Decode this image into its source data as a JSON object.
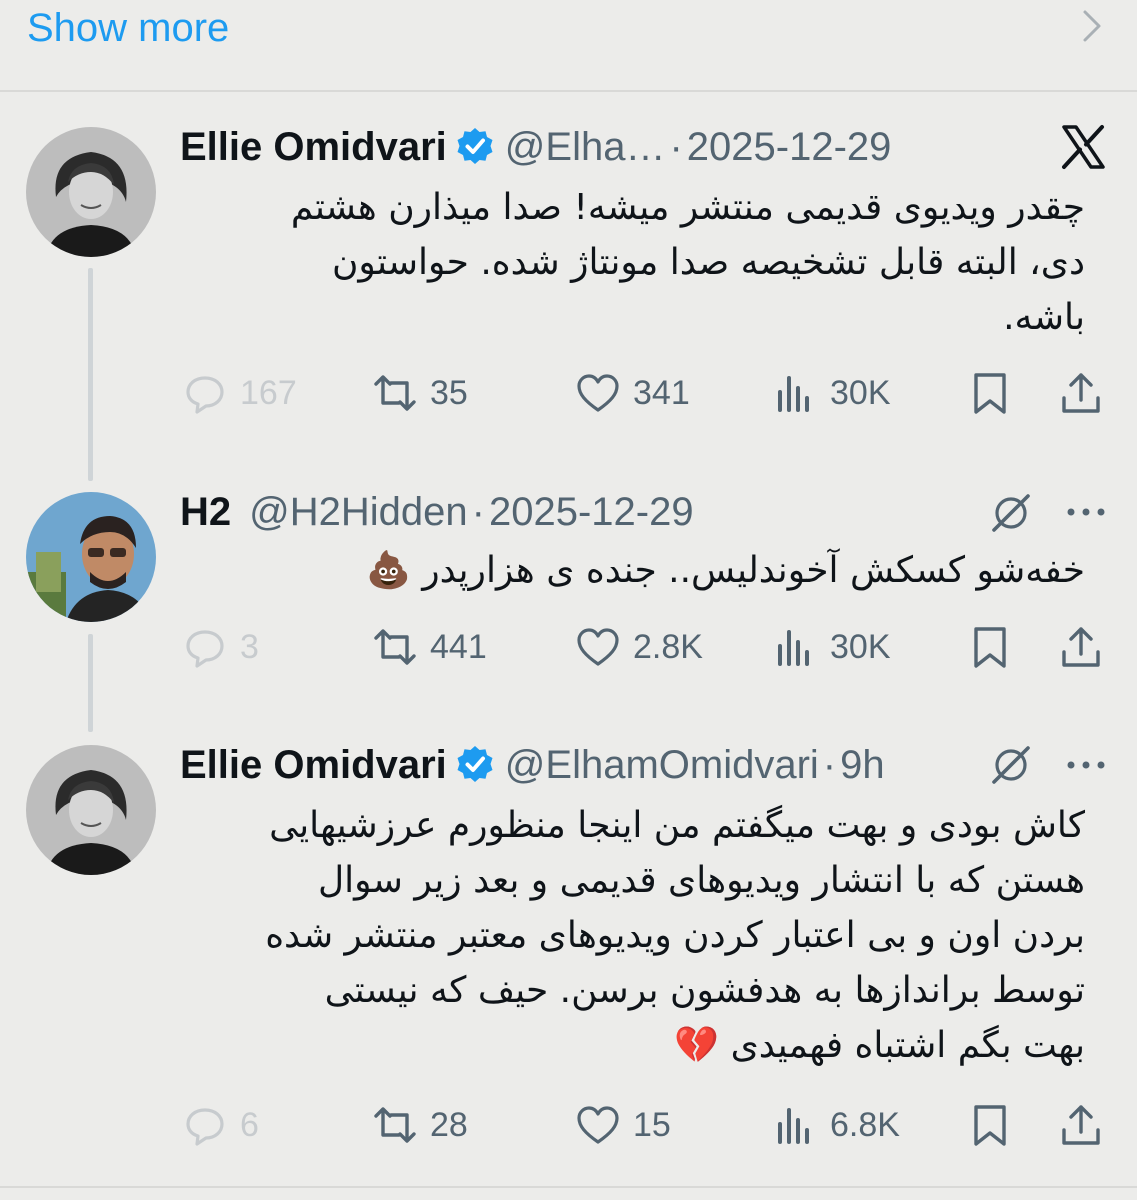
{
  "show_more": {
    "label": "Show more"
  },
  "tweets": [
    {
      "name": "Ellie Omidvari",
      "verified": true,
      "handle": "@Elha…",
      "separator": "·",
      "date": "2025-12-29",
      "corner_icon": "x-logo-icon",
      "text_lines": [
        "چقدر ویدیوی قدیمی منتشر میشه! صدا میذارن هشتم",
        "دی، البته قابل تشخیصه صدا مونتاژ شده. حواستون",
        "باشه."
      ],
      "replies": "167",
      "reposts": "35",
      "likes": "341",
      "views": "30K"
    },
    {
      "name": "H2",
      "verified": false,
      "handle": "@H2Hidden",
      "separator": "·",
      "date": "2025-12-29",
      "corner_icon": "grok-icon",
      "text_lines": [
        "خفه‌شو کسکش آخوندلیس.. جنده ی هزارپدر 💩"
      ],
      "replies": "3",
      "reposts": "441",
      "likes": "2.8K",
      "views": "30K"
    },
    {
      "name": "Ellie Omidvari",
      "verified": true,
      "handle": "@ElhamOmidvari",
      "separator": "·",
      "date": "9h",
      "corner_icon": "grok-icon",
      "text_lines": [
        "کاش بودی و بهت میگفتم من اینجا منظورم عرزشیهایی",
        "هستن که با انتشار ویدیوهای قدیمی و بعد زیر سوال",
        "بردن اون و بی اعتبار کردن ویدیوهای معتبر منتشر شده",
        "توسط براندازها به هدفشون برسن. حیف که نیستی",
        "بهت بگم اشتباه فهمیدی 💔"
      ],
      "replies": "6",
      "reposts": "28",
      "likes": "15",
      "views": "6.8K"
    }
  ],
  "colors": {
    "accent": "#1d9bf0",
    "muted": "#536471",
    "background": "#ececea"
  }
}
